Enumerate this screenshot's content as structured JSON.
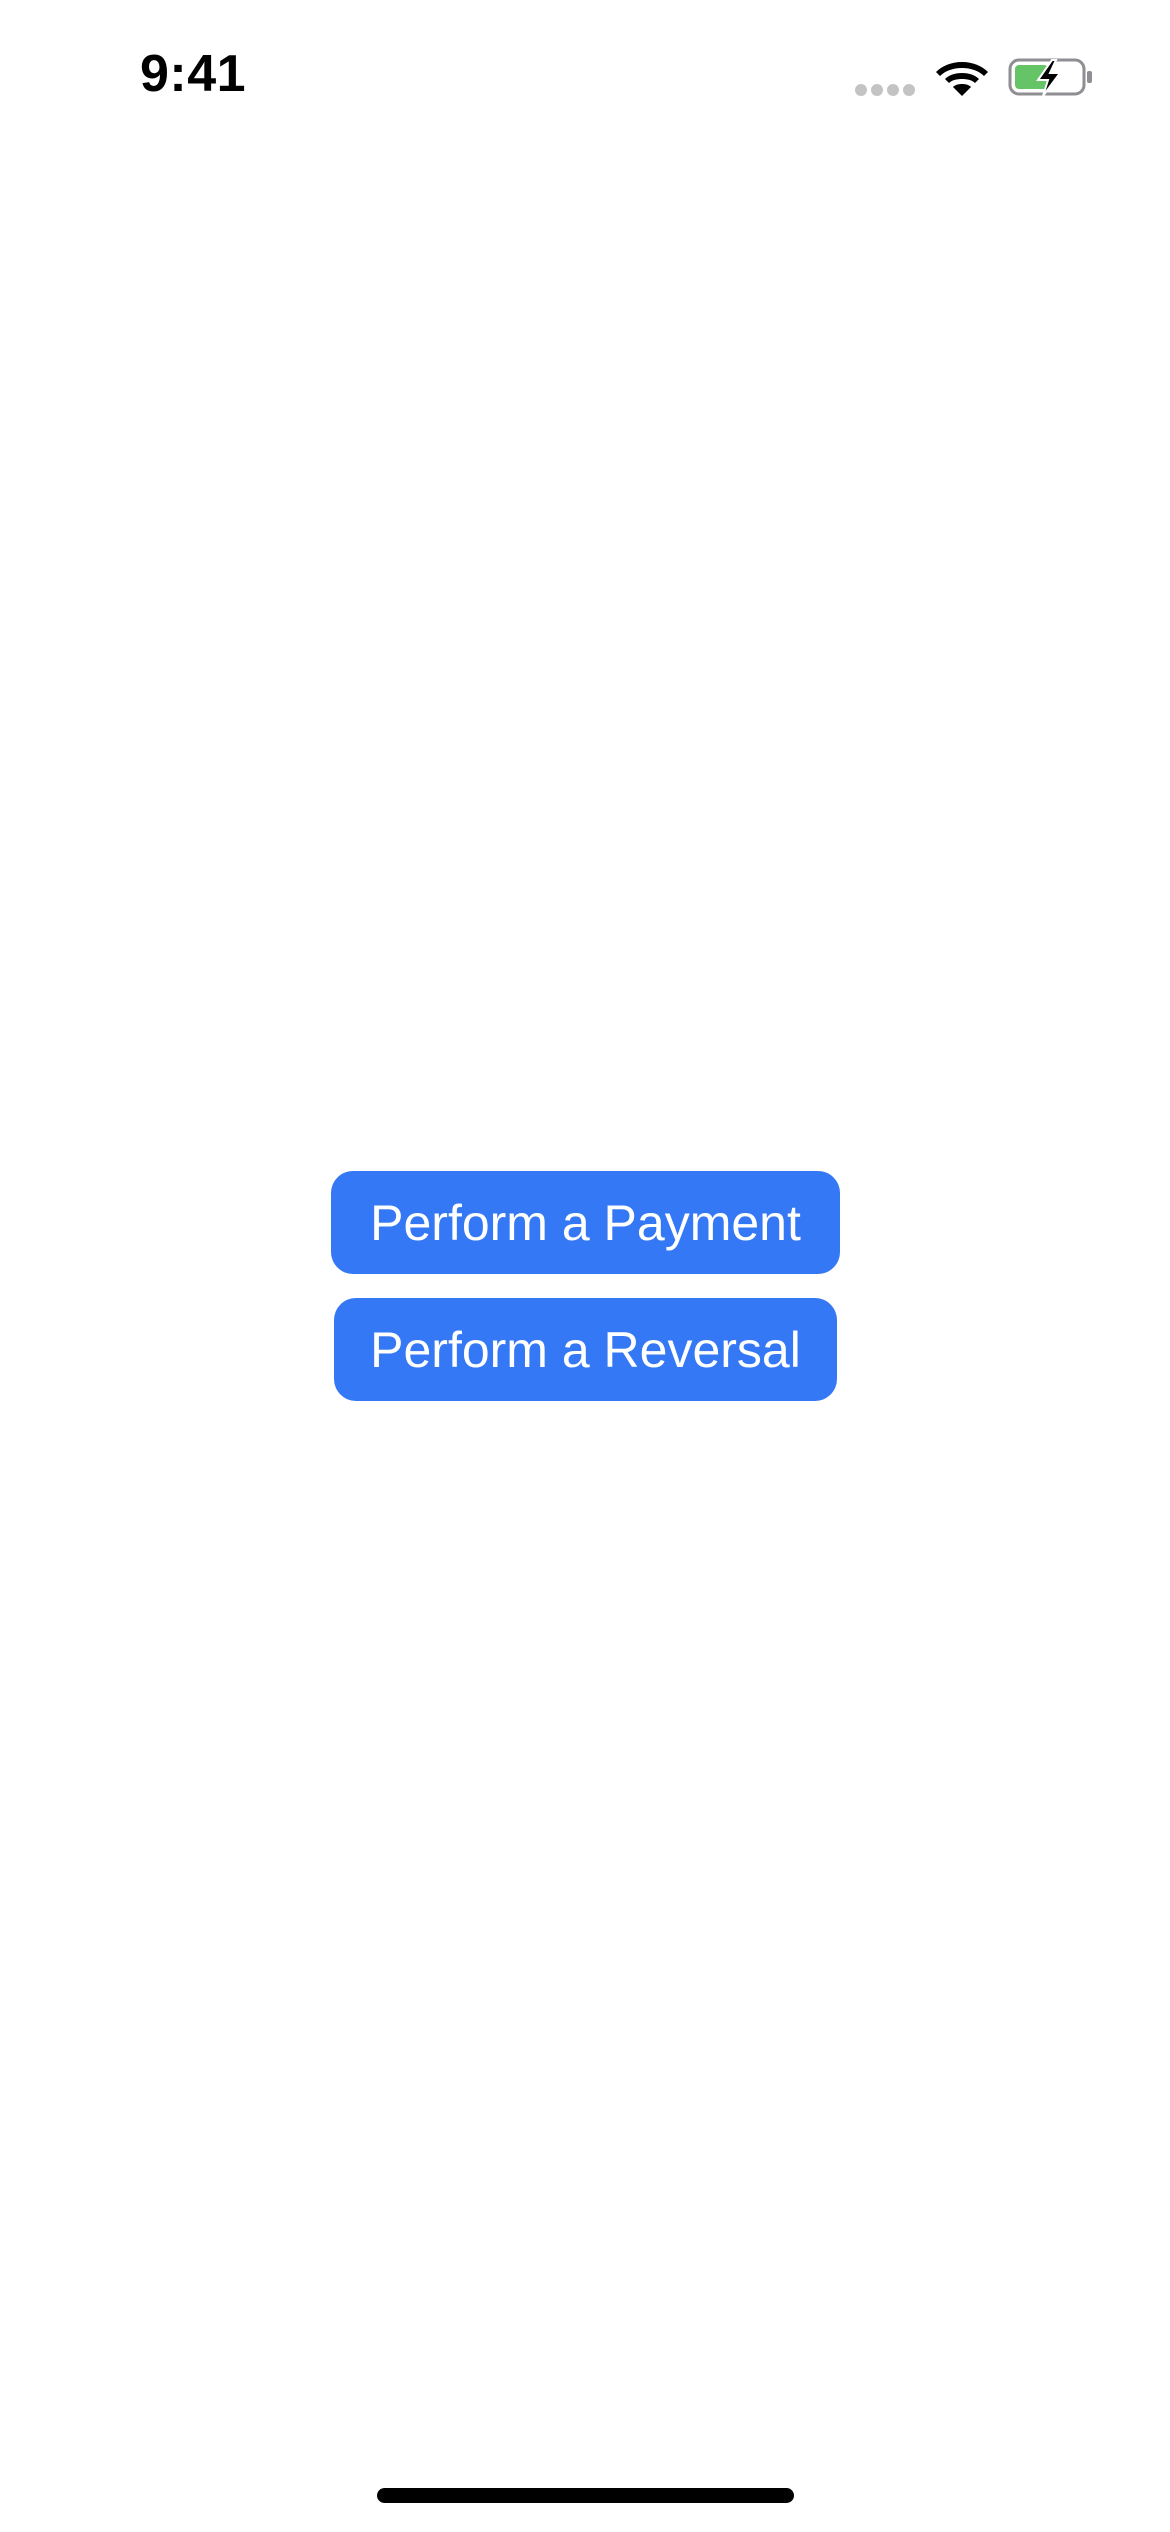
{
  "status_bar": {
    "time": "9:41",
    "icons": [
      "cellular-signal-icon",
      "wifi-icon",
      "battery-charging-icon"
    ],
    "battery_color": "#65c466"
  },
  "main": {
    "buttons": [
      {
        "label": "Perform a Payment"
      },
      {
        "label": "Perform a Reversal"
      }
    ]
  },
  "colors": {
    "accent": "#3478f6",
    "background": "#ffffff",
    "text_on_accent": "#ffffff"
  }
}
